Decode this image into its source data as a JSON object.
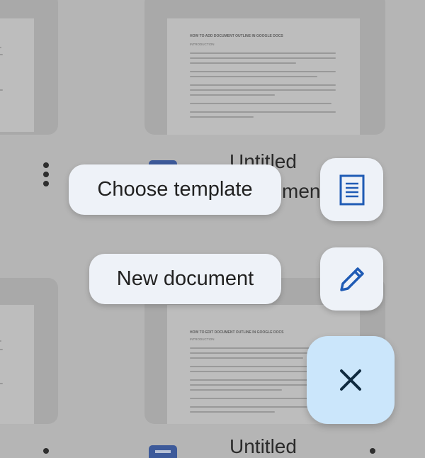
{
  "background": {
    "documents": [
      {
        "heading": "HOW TO ADD DOCUMENT OUTLINE IN GOOGLE DOCS",
        "subheading": "INTRODUCTION",
        "title": "Untitled"
      },
      {
        "heading": "HOW TO EDIT DOCUMENT OUTLINE IN GOOGLE DOCS",
        "subheading": "INTRODUCTION",
        "title": "Untitled"
      }
    ],
    "partial_title_fragment": "ment"
  },
  "fab_menu": {
    "choose_template_label": "Choose template",
    "new_document_label": "New document",
    "template_icon": "document-template-icon",
    "new_doc_icon": "pencil-icon",
    "close_icon": "close-icon"
  },
  "colors": {
    "scrim": "#b5b5b5",
    "pill_background": "#eef2f8",
    "fab_main_background": "#cbe6fb",
    "icon_blue": "#1f5bb5",
    "close_icon_color": "#0f2a3f"
  }
}
